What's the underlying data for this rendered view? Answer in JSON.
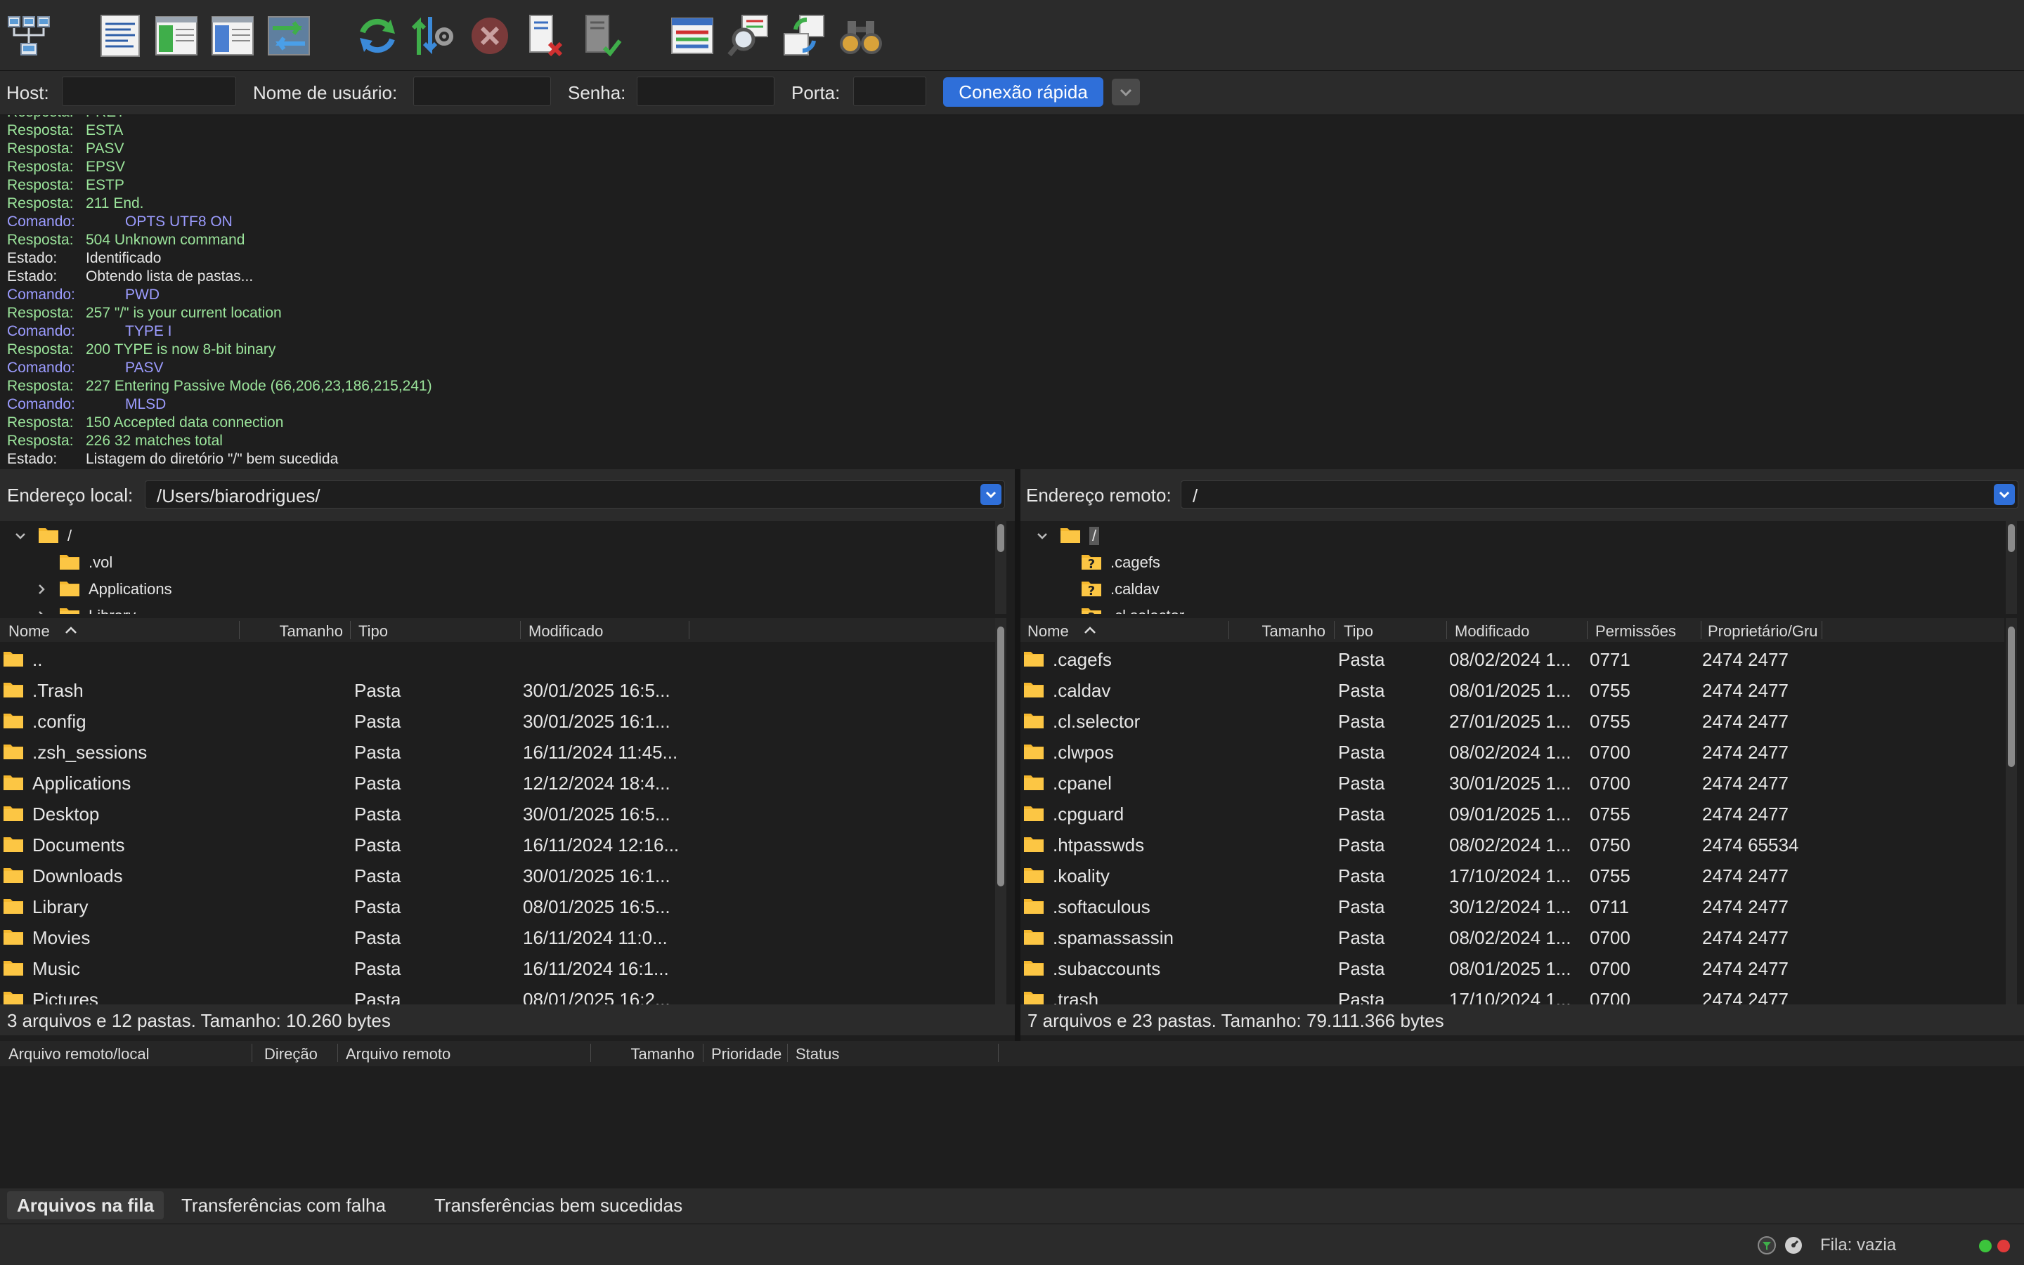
{
  "toolbar": {
    "buttons": [
      {
        "name": "site-manager",
        "icon": "site-manager-icon"
      },
      {
        "name": "toggle-message-log",
        "icon": "message-log-icon"
      },
      {
        "name": "toggle-local-tree",
        "icon": "local-tree-icon"
      },
      {
        "name": "toggle-remote-tree",
        "icon": "remote-tree-icon"
      },
      {
        "name": "toggle-transfer-queue",
        "icon": "transfer-queue-icon"
      },
      {
        "name": "refresh",
        "icon": "refresh-icon"
      },
      {
        "name": "process-queue",
        "icon": "process-queue-icon"
      },
      {
        "name": "cancel-operation",
        "icon": "cancel-icon"
      },
      {
        "name": "disconnect",
        "icon": "disconnect-icon"
      },
      {
        "name": "reconnect",
        "icon": "reconnect-icon"
      },
      {
        "name": "directory-filters",
        "icon": "filter-icon"
      },
      {
        "name": "compare-directories",
        "icon": "compare-icon"
      },
      {
        "name": "sync-browsing",
        "icon": "sync-browsing-icon"
      },
      {
        "name": "search-remote-files",
        "icon": "binoculars-icon"
      }
    ]
  },
  "quickconnect": {
    "host_label": "Host:",
    "host_value": "",
    "user_label": "Nome de usuário:",
    "user_value": "",
    "password_label": "Senha:",
    "password_value": "",
    "port_label": "Porta:",
    "port_value": "",
    "button_label": "Conexão rápida"
  },
  "log": [
    {
      "kind": "Resposta:",
      "type": "resp",
      "text": "PRET"
    },
    {
      "kind": "Resposta:",
      "type": "resp",
      "text": "ESTA"
    },
    {
      "kind": "Resposta:",
      "type": "resp",
      "text": "PASV"
    },
    {
      "kind": "Resposta:",
      "type": "resp",
      "text": "EPSV"
    },
    {
      "kind": "Resposta:",
      "type": "resp",
      "text": "ESTP"
    },
    {
      "kind": "Resposta:",
      "type": "resp",
      "text": "211 End."
    },
    {
      "kind": "Comando:",
      "type": "cmd",
      "text": "OPTS UTF8 ON"
    },
    {
      "kind": "Resposta:",
      "type": "resp",
      "text": "504 Unknown command"
    },
    {
      "kind": "Estado:",
      "type": "sta",
      "text": "Identificado"
    },
    {
      "kind": "Estado:",
      "type": "sta",
      "text": "Obtendo lista de pastas..."
    },
    {
      "kind": "Comando:",
      "type": "cmd",
      "text": "PWD"
    },
    {
      "kind": "Resposta:",
      "type": "resp",
      "text": "257 \"/\" is your current location"
    },
    {
      "kind": "Comando:",
      "type": "cmd",
      "text": "TYPE I"
    },
    {
      "kind": "Resposta:",
      "type": "resp",
      "text": "200 TYPE is now 8-bit binary"
    },
    {
      "kind": "Comando:",
      "type": "cmd",
      "text": "PASV"
    },
    {
      "kind": "Resposta:",
      "type": "resp",
      "text": "227 Entering Passive Mode (66,206,23,186,215,241)"
    },
    {
      "kind": "Comando:",
      "type": "cmd",
      "text": "MLSD"
    },
    {
      "kind": "Resposta:",
      "type": "resp",
      "text": "150 Accepted data connection"
    },
    {
      "kind": "Resposta:",
      "type": "resp",
      "text": "226 32 matches total"
    },
    {
      "kind": "Estado:",
      "type": "sta",
      "text": "Listagem do diretório \"/\" bem sucedida"
    }
  ],
  "local": {
    "address_label": "Endereço local:",
    "address_value": "/Users/biarodrigues/",
    "tree": [
      {
        "label": "/",
        "expanded": true,
        "icon": "folder-icon"
      },
      {
        "label": ".vol",
        "icon": "folder-icon"
      },
      {
        "label": "Applications",
        "icon": "folder-icon"
      },
      {
        "label": "Library",
        "icon": "folder-icon"
      }
    ],
    "columns": [
      "Nome",
      "Tamanho",
      "Tipo",
      "Modificado"
    ],
    "rows": [
      {
        "name": "..",
        "type": "",
        "modified": ""
      },
      {
        "name": ".Trash",
        "type": "Pasta",
        "modified": "30/01/2025 16:5..."
      },
      {
        "name": ".config",
        "type": "Pasta",
        "modified": "30/01/2025 16:1..."
      },
      {
        "name": ".zsh_sessions",
        "type": "Pasta",
        "modified": "16/11/2024 11:45..."
      },
      {
        "name": "Applications",
        "type": "Pasta",
        "modified": "12/12/2024 18:4..."
      },
      {
        "name": "Desktop",
        "type": "Pasta",
        "modified": "30/01/2025 16:5..."
      },
      {
        "name": "Documents",
        "type": "Pasta",
        "modified": "16/11/2024 12:16..."
      },
      {
        "name": "Downloads",
        "type": "Pasta",
        "modified": "30/01/2025 16:1..."
      },
      {
        "name": "Library",
        "type": "Pasta",
        "modified": "08/01/2025 16:5..."
      },
      {
        "name": "Movies",
        "type": "Pasta",
        "modified": "16/11/2024 11:0..."
      },
      {
        "name": "Music",
        "type": "Pasta",
        "modified": "16/11/2024 16:1..."
      },
      {
        "name": "Pictures",
        "type": "Pasta",
        "modified": "08/01/2025 16:2..."
      }
    ],
    "status": "3 arquivos e 12 pastas. Tamanho: 10.260 bytes"
  },
  "remote": {
    "address_label": "Endereço remoto:",
    "address_value": "/",
    "tree": [
      {
        "label": "/",
        "expanded": true,
        "icon": "folder-icon"
      },
      {
        "label": ".cagefs",
        "icon": "unknown-folder-icon"
      },
      {
        "label": ".caldav",
        "icon": "unknown-folder-icon"
      },
      {
        "label": ".cl.selector",
        "icon": "unknown-folder-icon"
      }
    ],
    "columns": [
      "Nome",
      "Tamanho",
      "Tipo",
      "Modificado",
      "Permissões",
      "Proprietário/Gru"
    ],
    "rows": [
      {
        "name": ".cagefs",
        "type": "Pasta",
        "modified": "08/02/2024 1...",
        "perms": "0771",
        "owner": "2474 2477"
      },
      {
        "name": ".caldav",
        "type": "Pasta",
        "modified": "08/01/2025 1...",
        "perms": "0755",
        "owner": "2474 2477"
      },
      {
        "name": ".cl.selector",
        "type": "Pasta",
        "modified": "27/01/2025 1...",
        "perms": "0755",
        "owner": "2474 2477"
      },
      {
        "name": ".clwpos",
        "type": "Pasta",
        "modified": "08/02/2024 1...",
        "perms": "0700",
        "owner": "2474 2477"
      },
      {
        "name": ".cpanel",
        "type": "Pasta",
        "modified": "30/01/2025 1...",
        "perms": "0700",
        "owner": "2474 2477"
      },
      {
        "name": ".cpguard",
        "type": "Pasta",
        "modified": "09/01/2025 1...",
        "perms": "0755",
        "owner": "2474 2477"
      },
      {
        "name": ".htpasswds",
        "type": "Pasta",
        "modified": "08/02/2024 1...",
        "perms": "0750",
        "owner": "2474 65534"
      },
      {
        "name": ".koality",
        "type": "Pasta",
        "modified": "17/10/2024 1...",
        "perms": "0755",
        "owner": "2474 2477"
      },
      {
        "name": ".softaculous",
        "type": "Pasta",
        "modified": "30/12/2024 1...",
        "perms": "0711",
        "owner": "2474 2477"
      },
      {
        "name": ".spamassassin",
        "type": "Pasta",
        "modified": "08/02/2024 1...",
        "perms": "0700",
        "owner": "2474 2477"
      },
      {
        "name": ".subaccounts",
        "type": "Pasta",
        "modified": "08/01/2025 1...",
        "perms": "0700",
        "owner": "2474 2477"
      },
      {
        "name": ".trash",
        "type": "Pasta",
        "modified": "17/10/2024 1...",
        "perms": "0700",
        "owner": "2474 2477"
      }
    ],
    "status": "7 arquivos e 23 pastas. Tamanho: 79.111.366 bytes"
  },
  "queue": {
    "columns": [
      "Arquivo remoto/local",
      "Direção",
      "Arquivo remoto",
      "Tamanho",
      "Prioridade",
      "Status"
    ],
    "tabs": [
      "Arquivos na fila",
      "Transferências com falha",
      "Transferências bem sucedidas"
    ],
    "active_tab": 0
  },
  "statusbar": {
    "queue_text": "Fila: vazia"
  },
  "colors": {
    "accent": "#2f6fd9",
    "folder": "#f5b82e",
    "response": "#9be49b",
    "command": "#9c9cff",
    "activity_green": "#3cc43c",
    "activity_red": "#e03a3a"
  }
}
